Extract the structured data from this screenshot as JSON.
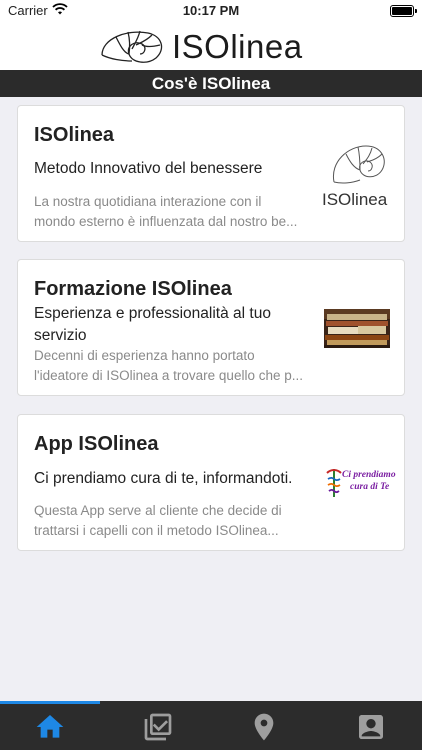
{
  "status": {
    "carrier": "Carrier",
    "time": "10:17 PM"
  },
  "header": {
    "logo_text": "ISOlinea"
  },
  "section": {
    "title": "Cos'è ISOlinea"
  },
  "cards": [
    {
      "title": "ISOlinea",
      "subtitle": "Metodo Innovativo del benessere",
      "desc_line1": "La nostra quotidiana interazione con il",
      "desc_line2": "mondo esterno è influenzata dal nostro be...",
      "thumb_text": "ISOlinea"
    },
    {
      "title": "Formazione ISOlinea",
      "subtitle": "Esperienza e professionalità al tuo servizio",
      "desc_line1": "Decenni di esperienza hanno portato",
      "desc_line2": "l'ideatore di ISOlinea a trovare quello che p..."
    },
    {
      "title": "App ISOlinea",
      "subtitle": "Ci prendiamo cura di te, informandoti.",
      "desc_line1": "Questa App serve al cliente che decide di",
      "desc_line2": "trattarsi i capelli con il metodo ISOlinea...",
      "thumb_text_1": "Ci prendiamo",
      "thumb_text_2": "cura di Te"
    }
  ],
  "tabs": [
    {
      "name": "home",
      "active": true
    },
    {
      "name": "checklist",
      "active": false
    },
    {
      "name": "location",
      "active": false
    },
    {
      "name": "profile",
      "active": false
    }
  ],
  "colors": {
    "accent": "#1e88e5",
    "section_bar": "#2b2b2b",
    "tab_bar": "#2c2c2c",
    "inactive_icon": "#9e9e9e"
  }
}
